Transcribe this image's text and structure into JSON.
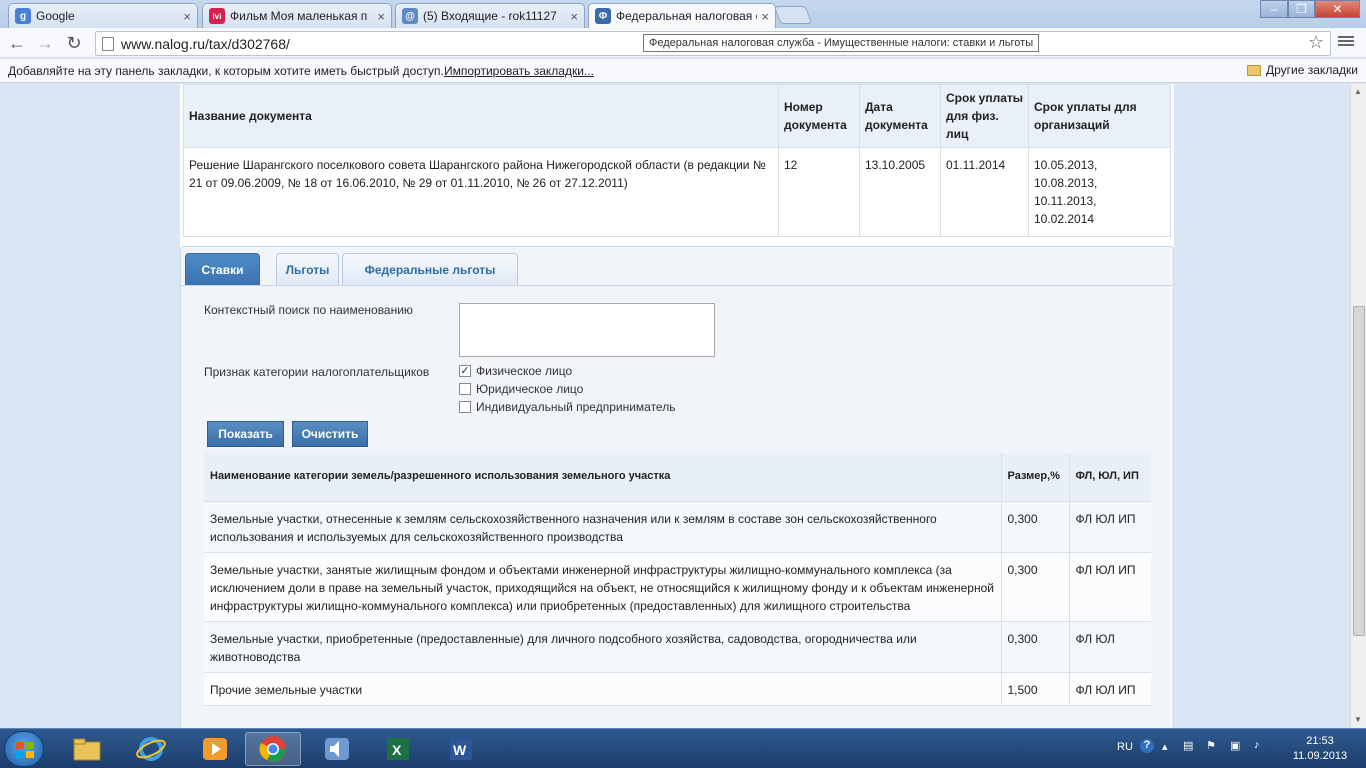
{
  "browser": {
    "tabs": [
      {
        "title": "Google",
        "icon": "google-icon",
        "color": "#4a7fd8",
        "glyph": "g"
      },
      {
        "title": "Фильм Моя маленькая п",
        "icon": "ivi-icon",
        "color": "#d6214d",
        "glyph": "ivi"
      },
      {
        "title": "(5) Входящие - rok11127",
        "icon": "mail-icon",
        "color": "#5e8ac2",
        "glyph": "@"
      },
      {
        "title": "Федеральная налоговая с",
        "icon": "nalog-icon",
        "color": "#3b6aa8",
        "glyph": "Ф"
      }
    ],
    "url": "www.nalog.ru/tax/d302768/",
    "tooltip": "Федеральная налоговая служба - Имущественные налоги: ставки и льготы",
    "bookmarks_hint": "Добавляйте на эту панель закладки, к которым хотите иметь быстрый доступ.",
    "bookmarks_import": "Импортировать закладки...",
    "other_bookmarks": "Другие закладки"
  },
  "document_table": {
    "headers": [
      "Название документа",
      "Номер документа",
      "Дата документа",
      "Срок уплаты для физ. лиц",
      "Срок уплаты для организаций"
    ],
    "row": {
      "name": "Решение Шарангского поселкового совета Шарангского района Нижегородской области (в редакции № 21 от 09.06.2009, № 18 от 16.06.2010, № 29 от 01.11.2010, № 26 от 27.12.2011)",
      "number": "12",
      "date": "13.10.2005",
      "due_individuals": "01.11.2014",
      "due_organizations": [
        "10.05.2013,",
        "10.08.2013,",
        "10.11.2013,",
        "10.02.2014"
      ]
    }
  },
  "panel_tabs": [
    "Ставки",
    "Льготы",
    "Федеральные льготы"
  ],
  "filter": {
    "search_label": "Контекстный поиск по наименованию",
    "search_value": "",
    "category_label": "Признак категории налогоплательщиков",
    "options": [
      {
        "label": "Физическое лицо",
        "checked": true
      },
      {
        "label": "Юридическое лицо",
        "checked": false
      },
      {
        "label": "Индивидуальный предприниматель",
        "checked": false
      }
    ],
    "show_button": "Показать",
    "clear_button": "Очистить"
  },
  "rates_table": {
    "headers": [
      "Наименование категории земель/разрешенного использования земельного участка",
      "Размер,%",
      "ФЛ, ЮЛ, ИП"
    ],
    "rows": [
      {
        "name": "Земельные участки, отнесенные к землям сельскохозяйственного назначения или к землям в составе зон сельскохозяйственного использования и используемых для сельскохозяйственного производства",
        "rate": "0,300",
        "who": "ФЛ ЮЛ ИП"
      },
      {
        "name": "Земельные участки, занятые жилищным фондом и объектами инженерной инфраструктуры жилищно-коммунального комплекса (за исключением доли в праве на земельный участок, приходящийся на объект, не относящийся к жилищному фонду и к объектам инженерной инфраструктуры жилищно-коммунального комплекса) или приобретенных (предоставленных) для жилищного строительства",
        "rate": "0,300",
        "who": "ФЛ ЮЛ ИП"
      },
      {
        "name": "Земельные участки, приобретенные (предоставленные) для личного подсобного хозяйства, садоводства, огородничества или животноводства",
        "rate": "0,300",
        "who": "ФЛ ЮЛ"
      },
      {
        "name": "Прочие земельные участки",
        "rate": "1,500",
        "who": "ФЛ ЮЛ ИП"
      }
    ]
  },
  "taskbar": {
    "apps": [
      "explorer-icon",
      "ie-icon",
      "media-player-icon",
      "chrome-icon",
      "volume-app-icon",
      "excel-icon",
      "word-icon"
    ],
    "lang": "RU",
    "time": "21:53",
    "date": "11.09.2013"
  }
}
